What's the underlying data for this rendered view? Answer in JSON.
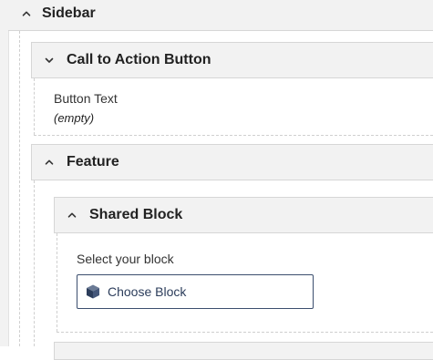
{
  "sidebar": {
    "title": "Sidebar",
    "cta": {
      "title": "Call to Action Button",
      "field_label": "Button Text",
      "field_value": "(empty)"
    },
    "feature": {
      "title": "Feature",
      "shared_block": {
        "title": "Shared Block",
        "select_label": "Select your block",
        "choose_label": "Choose Block"
      }
    }
  },
  "icons": {
    "expanded": "chevron-up-icon",
    "collapsed": "chevron-down-icon",
    "block": "cube-icon"
  },
  "colors": {
    "header_bg": "#f2f2f2",
    "button_border": "#3b4e6e",
    "button_text": "#2c3d5b"
  }
}
